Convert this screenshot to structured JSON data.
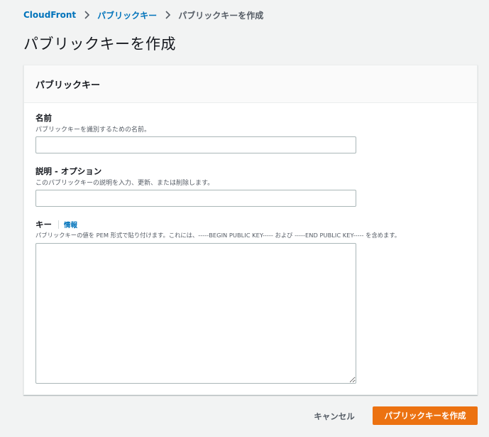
{
  "breadcrumb": {
    "items": [
      {
        "label": "CloudFront"
      },
      {
        "label": "パブリックキー"
      },
      {
        "label": "パブリックキーを作成"
      }
    ]
  },
  "page": {
    "title": "パブリックキーを作成"
  },
  "panel": {
    "title": "パブリックキー",
    "fields": {
      "name": {
        "label": "名前",
        "description": "パブリックキーを識別するための名前。",
        "value": ""
      },
      "description": {
        "label": "説明 - オプション",
        "description": "このパブリックキーの説明を入力、更新、または削除します。",
        "value": ""
      },
      "key": {
        "label": "キー",
        "info_label": "情報",
        "description": "パブリックキーの値を PEM 形式で貼り付けます。これには、-----BEGIN PUBLIC KEY----- および -----END PUBLIC KEY----- を含めます。",
        "value": ""
      }
    }
  },
  "actions": {
    "cancel_label": "キャンセル",
    "submit_label": "パブリックキーを作成"
  },
  "colors": {
    "link": "#0073bb",
    "primary": "#ec7211",
    "background": "#f2f3f3"
  }
}
